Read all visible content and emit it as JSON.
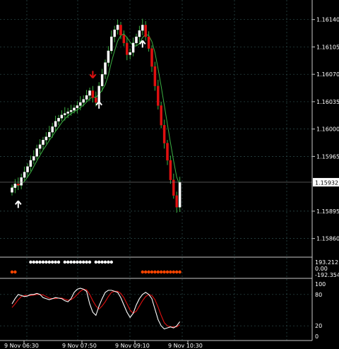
{
  "chart_data": {
    "type": "candlestick",
    "instrument_hint": "EURUSD-like price",
    "colors": {
      "background": "#000000",
      "grid": "#2f4f4f",
      "bull": "#ffffff",
      "bear": "#e01010",
      "wick": "#3cb043",
      "ma": "#3cb043",
      "arrow_up": "#ffffff",
      "arrow_down": "#e01010",
      "dots_white": "#ffffff",
      "dots_orange": "#ff4500",
      "stoch_main": "#ffffff",
      "stoch_signal": "#e01010",
      "axis_text": "#ffffff",
      "price_tag_bg": "#ffffff",
      "price_tag_text": "#000000"
    },
    "price_axis": {
      "ticks": [
        "1.16140",
        "1.16105",
        "1.16070",
        "1.16035",
        "1.16000",
        "1.15965",
        "1.15895",
        "1.15860"
      ],
      "ylim": [
        1.15838,
        1.16165
      ],
      "current_price": "1.15932"
    },
    "time_axis": {
      "ticks": [
        "9 Nov 06:30",
        "9 Nov 07:50",
        "9 Nov 09:10",
        "9 Nov 10:30"
      ]
    },
    "candles_close": [
      1.15925,
      1.1593,
      1.15928,
      1.15938,
      1.15945,
      1.15952,
      1.1596,
      1.15965,
      1.15975,
      1.1598,
      1.15986,
      1.1599,
      1.15996,
      1.16003,
      1.1601,
      1.16014,
      1.16018,
      1.1602,
      1.16022,
      1.16024,
      1.16027,
      1.1603,
      1.16034,
      1.16038,
      1.16043,
      1.16049,
      1.1604,
      1.16034,
      1.16055,
      1.1607,
      1.16085,
      1.161,
      1.16118,
      1.16127,
      1.16133,
      1.1612,
      1.1611,
      1.16095,
      1.16098,
      1.1611,
      1.16118,
      1.16126,
      1.16133,
      1.16118,
      1.16103,
      1.1608,
      1.16055,
      1.1603,
      1.16005,
      1.15982,
      1.1596,
      1.15935,
      1.15915,
      1.159,
      1.15932
    ],
    "arrows": [
      {
        "dir": "up",
        "candle": 2
      },
      {
        "dir": "down",
        "candle": 26
      },
      {
        "dir": "up",
        "candle": 28
      },
      {
        "dir": "up",
        "candle": 42
      }
    ],
    "signal_panel": {
      "levels": [
        "193.2121",
        "0.00",
        "-192.3545"
      ],
      "white_dot_candles": [
        6,
        7,
        8,
        9,
        10,
        11,
        12,
        13,
        14,
        15,
        17,
        18,
        19,
        20,
        21,
        22,
        23,
        24,
        25,
        27,
        28,
        29,
        30,
        31,
        32
      ],
      "orange_dot_candles": [
        0,
        1,
        42,
        43,
        44,
        45,
        46,
        47,
        48,
        49,
        50,
        51,
        52,
        53,
        54
      ]
    },
    "stochastic": {
      "ticks": [
        "100",
        "80",
        "20",
        "0"
      ],
      "ylim": [
        0,
        100
      ],
      "main": [
        62,
        72,
        80,
        78,
        76,
        77,
        80,
        80,
        82,
        80,
        74,
        72,
        70,
        72,
        74,
        73,
        72,
        68,
        66,
        72,
        84,
        90,
        92,
        90,
        86,
        62,
        46,
        40,
        58,
        72,
        84,
        88,
        88,
        86,
        84,
        74,
        60,
        46,
        36,
        44,
        60,
        72,
        80,
        84,
        80,
        72,
        52,
        32,
        20,
        14,
        16,
        18,
        16,
        20,
        28
      ],
      "signal": [
        55,
        62,
        70,
        76,
        78,
        78,
        78,
        79,
        80,
        80,
        79,
        76,
        73,
        72,
        72,
        73,
        73,
        71,
        69,
        70,
        74,
        80,
        86,
        90,
        89,
        80,
        68,
        58,
        52,
        58,
        66,
        76,
        84,
        86,
        86,
        82,
        74,
        62,
        50,
        44,
        48,
        58,
        68,
        76,
        80,
        78,
        70,
        56,
        40,
        26,
        20,
        18,
        18,
        18,
        22
      ]
    }
  }
}
